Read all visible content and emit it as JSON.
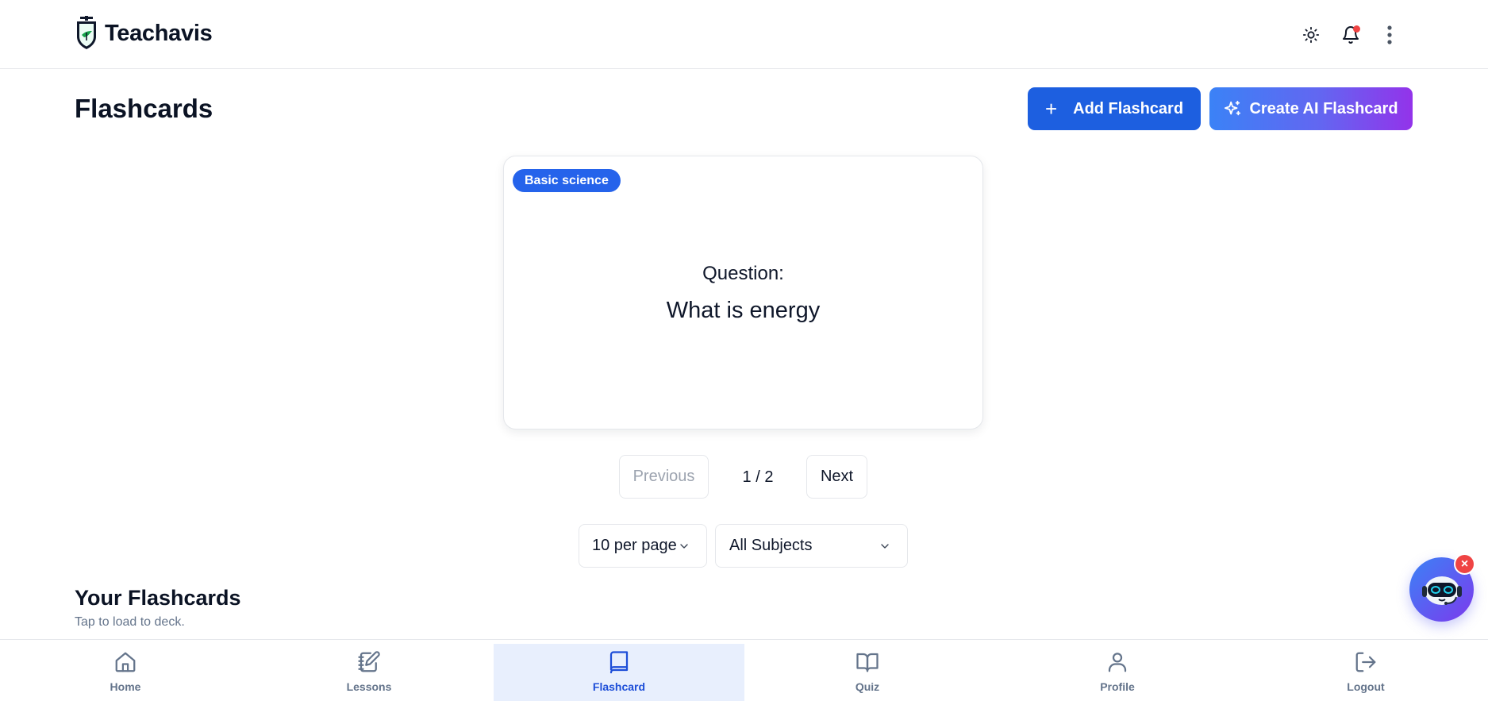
{
  "app": {
    "name": "Teachavis"
  },
  "header": {
    "icons": [
      "theme-sun-icon",
      "notification-bell-icon",
      "more-vertical-icon"
    ],
    "notification_dot_color": "#ef4444"
  },
  "main": {
    "title": "Flashcards",
    "add_button_label": "Add Flashcard",
    "ai_button_label": "Create AI Flashcard"
  },
  "flashcard": {
    "subject": "Basic science",
    "label": "Question:",
    "text": "What is energy"
  },
  "pagination": {
    "previous_label": "Previous",
    "indicator": "1 / 2",
    "next_label": "Next"
  },
  "filters": {
    "per_page": "10 per page",
    "subject": "All Subjects"
  },
  "your_flashcards": {
    "title": "Your Flashcards",
    "subtitle": "Tap to load to deck."
  },
  "chatbot": {
    "close_glyph": "×"
  },
  "bottom_nav": {
    "items": [
      {
        "label": "Home",
        "icon": "home-icon"
      },
      {
        "label": "Lessons",
        "icon": "notebook-pen-icon"
      },
      {
        "label": "Flashcard",
        "icon": "book-icon",
        "active": true
      },
      {
        "label": "Quiz",
        "icon": "open-book-icon"
      },
      {
        "label": "Profile",
        "icon": "user-icon"
      },
      {
        "label": "Logout",
        "icon": "logout-icon"
      }
    ]
  },
  "colors": {
    "primary": "#1d5fe0",
    "badge": "#2563eb",
    "ai_gradient_start": "#3b82f6",
    "ai_gradient_end": "#9333ea",
    "active_nav_bg": "#e8effd"
  }
}
